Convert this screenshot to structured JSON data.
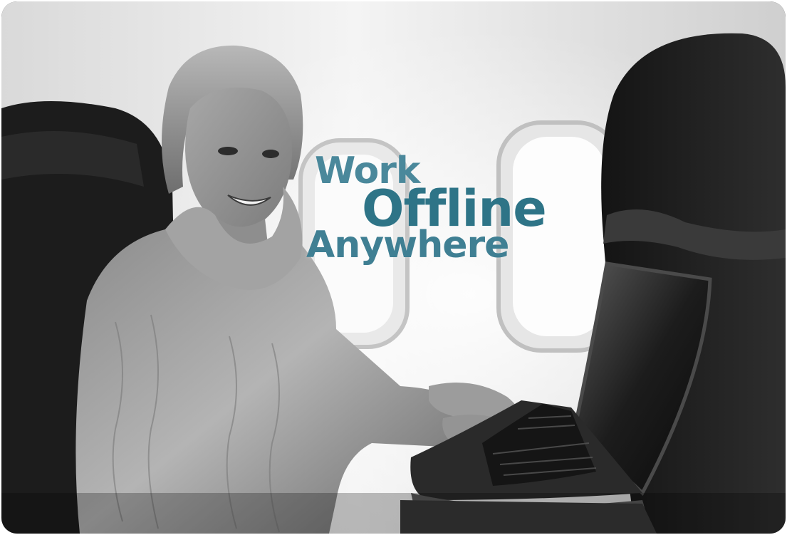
{
  "headline": {
    "line1": "Work",
    "line2": "Offline",
    "line3": "Anywhere"
  },
  "colors": {
    "headline_teal": "#3f7f93",
    "headline_dark_teal": "#2e7487"
  },
  "photo": {
    "style": "black-and-white",
    "subject_icons": [
      "woman-passenger",
      "laptop",
      "airplane-window",
      "airplane-seat"
    ]
  }
}
